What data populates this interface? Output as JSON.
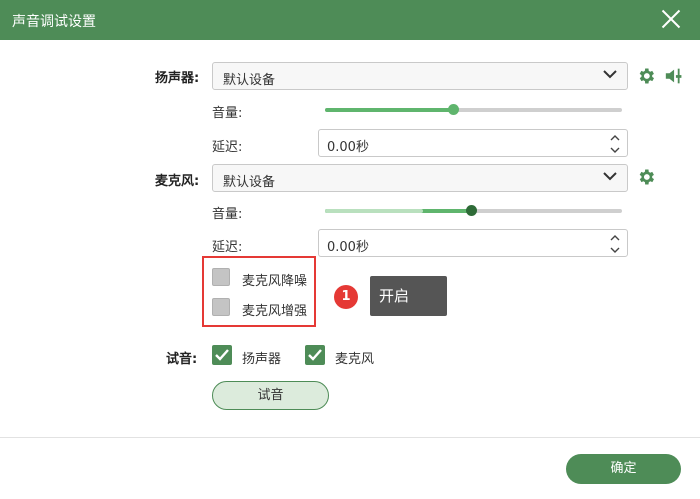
{
  "window": {
    "title": "声音调试设置"
  },
  "speaker": {
    "label": "扬声器:",
    "device": "默认设备",
    "volume_label": "音量:",
    "volume_level": 0.43,
    "delay_label": "延迟:",
    "delay_value": "0.00秒"
  },
  "microphone": {
    "label": "麦克风:",
    "device": "默认设备",
    "volume_label": "音量:",
    "volume_level": 0.49,
    "input_level": 0.33,
    "delay_label": "延迟:",
    "delay_value": "0.00秒"
  },
  "enhancements": {
    "noise_reduction": "麦克风降噪",
    "boost": "麦克风增强"
  },
  "annotation": {
    "number": "1",
    "tooltip": "开启"
  },
  "test": {
    "label": "试音:",
    "speaker": "扬声器",
    "microphone": "麦克风",
    "button": "试音"
  },
  "footer": {
    "confirm": "确定"
  },
  "colors": {
    "accent": "#4e8c57",
    "slider_fill": "#5fb56d",
    "highlight": "#e53935"
  },
  "icons": [
    "close-icon",
    "chevron-down-icon",
    "gear-icon",
    "speaker-volume-icon",
    "chevron-up-icon",
    "check-icon"
  ]
}
